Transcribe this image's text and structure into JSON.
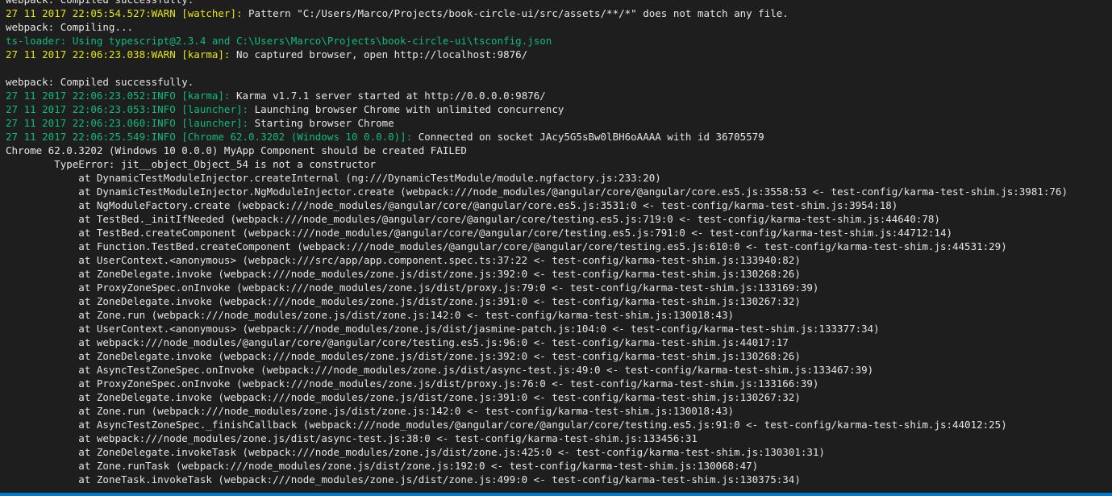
{
  "terminal": {
    "lines": [
      [
        {
          "text": "webpack: Compiled successfully.",
          "color": "white"
        }
      ],
      [
        {
          "text": "27 11 2017 22:05:54.527:WARN [watcher]: ",
          "color": "yellow"
        },
        {
          "text": "Pattern \"C:/Users/Marco/Projects/book-circle-ui/src/assets/**/*\" does not match any file.",
          "color": "white"
        }
      ],
      [
        {
          "text": "webpack: Compiling...",
          "color": "white"
        }
      ],
      [
        {
          "text": "ts-loader: Using typescript@2.3.4 and C:\\Users\\Marco\\Projects\\book-circle-ui\\tsconfig.json",
          "color": "green"
        }
      ],
      [
        {
          "text": "27 11 2017 22:06:23.038:WARN [karma]: ",
          "color": "yellow"
        },
        {
          "text": "No captured browser, open http://localhost:9876/",
          "color": "white"
        }
      ],
      [
        {
          "text": "",
          "color": "white"
        }
      ],
      [
        {
          "text": "webpack: Compiled successfully.",
          "color": "white"
        }
      ],
      [
        {
          "text": "27 11 2017 22:06:23.052:INFO [karma]: ",
          "color": "green"
        },
        {
          "text": "Karma v1.7.1 server started at http://0.0.0.0:9876/",
          "color": "white"
        }
      ],
      [
        {
          "text": "27 11 2017 22:06:23.053:INFO [launcher]: ",
          "color": "green"
        },
        {
          "text": "Launching browser Chrome with unlimited concurrency",
          "color": "white"
        }
      ],
      [
        {
          "text": "27 11 2017 22:06:23.060:INFO [launcher]: ",
          "color": "green"
        },
        {
          "text": "Starting browser Chrome",
          "color": "white"
        }
      ],
      [
        {
          "text": "27 11 2017 22:06:25.549:INFO [Chrome 62.0.3202 (Windows 10 0.0.0)]: ",
          "color": "green"
        },
        {
          "text": "Connected on socket JAcy5G5sBw0lBH6oAAAA with id 36705579",
          "color": "white"
        }
      ],
      [
        {
          "text": "Chrome 62.0.3202 (Windows 10 0.0.0) MyApp Component should be created FAILED",
          "color": "white"
        }
      ],
      [
        {
          "text": "        TypeError: jit__object_Object_54 is not a constructor",
          "color": "white"
        }
      ],
      [
        {
          "text": "            at DynamicTestModuleInjector.createInternal (ng:///DynamicTestModule/module.ngfactory.js:233:20)",
          "color": "white"
        }
      ],
      [
        {
          "text": "            at DynamicTestModuleInjector.NgModuleInjector.create (webpack:///node_modules/@angular/core/@angular/core.es5.js:3558:53 <- test-config/karma-test-shim.js:3981:76)",
          "color": "white"
        }
      ],
      [
        {
          "text": "            at NgModuleFactory.create (webpack:///node_modules/@angular/core/@angular/core.es5.js:3531:0 <- test-config/karma-test-shim.js:3954:18)",
          "color": "white"
        }
      ],
      [
        {
          "text": "            at TestBed._initIfNeeded (webpack:///node_modules/@angular/core/@angular/core/testing.es5.js:719:0 <- test-config/karma-test-shim.js:44640:78)",
          "color": "white"
        }
      ],
      [
        {
          "text": "            at TestBed.createComponent (webpack:///node_modules/@angular/core/@angular/core/testing.es5.js:791:0 <- test-config/karma-test-shim.js:44712:14)",
          "color": "white"
        }
      ],
      [
        {
          "text": "            at Function.TestBed.createComponent (webpack:///node_modules/@angular/core/@angular/core/testing.es5.js:610:0 <- test-config/karma-test-shim.js:44531:29)",
          "color": "white"
        }
      ],
      [
        {
          "text": "            at UserContext.<anonymous> (webpack:///src/app/app.component.spec.ts:37:22 <- test-config/karma-test-shim.js:133940:82)",
          "color": "white"
        }
      ],
      [
        {
          "text": "            at ZoneDelegate.invoke (webpack:///node_modules/zone.js/dist/zone.js:392:0 <- test-config/karma-test-shim.js:130268:26)",
          "color": "white"
        }
      ],
      [
        {
          "text": "            at ProxyZoneSpec.onInvoke (webpack:///node_modules/zone.js/dist/proxy.js:79:0 <- test-config/karma-test-shim.js:133169:39)",
          "color": "white"
        }
      ],
      [
        {
          "text": "            at ZoneDelegate.invoke (webpack:///node_modules/zone.js/dist/zone.js:391:0 <- test-config/karma-test-shim.js:130267:32)",
          "color": "white"
        }
      ],
      [
        {
          "text": "            at Zone.run (webpack:///node_modules/zone.js/dist/zone.js:142:0 <- test-config/karma-test-shim.js:130018:43)",
          "color": "white"
        }
      ],
      [
        {
          "text": "            at UserContext.<anonymous> (webpack:///node_modules/zone.js/dist/jasmine-patch.js:104:0 <- test-config/karma-test-shim.js:133377:34)",
          "color": "white"
        }
      ],
      [
        {
          "text": "            at webpack:///node_modules/@angular/core/@angular/core/testing.es5.js:96:0 <- test-config/karma-test-shim.js:44017:17",
          "color": "white"
        }
      ],
      [
        {
          "text": "            at ZoneDelegate.invoke (webpack:///node_modules/zone.js/dist/zone.js:392:0 <- test-config/karma-test-shim.js:130268:26)",
          "color": "white"
        }
      ],
      [
        {
          "text": "            at AsyncTestZoneSpec.onInvoke (webpack:///node_modules/zone.js/dist/async-test.js:49:0 <- test-config/karma-test-shim.js:133467:39)",
          "color": "white"
        }
      ],
      [
        {
          "text": "            at ProxyZoneSpec.onInvoke (webpack:///node_modules/zone.js/dist/proxy.js:76:0 <- test-config/karma-test-shim.js:133166:39)",
          "color": "white"
        }
      ],
      [
        {
          "text": "            at ZoneDelegate.invoke (webpack:///node_modules/zone.js/dist/zone.js:391:0 <- test-config/karma-test-shim.js:130267:32)",
          "color": "white"
        }
      ],
      [
        {
          "text": "            at Zone.run (webpack:///node_modules/zone.js/dist/zone.js:142:0 <- test-config/karma-test-shim.js:130018:43)",
          "color": "white"
        }
      ],
      [
        {
          "text": "            at AsyncTestZoneSpec._finishCallback (webpack:///node_modules/@angular/core/@angular/core/testing.es5.js:91:0 <- test-config/karma-test-shim.js:44012:25)",
          "color": "white"
        }
      ],
      [
        {
          "text": "            at webpack:///node_modules/zone.js/dist/async-test.js:38:0 <- test-config/karma-test-shim.js:133456:31",
          "color": "white"
        }
      ],
      [
        {
          "text": "            at ZoneDelegate.invokeTask (webpack:///node_modules/zone.js/dist/zone.js:425:0 <- test-config/karma-test-shim.js:130301:31)",
          "color": "white"
        }
      ],
      [
        {
          "text": "            at Zone.runTask (webpack:///node_modules/zone.js/dist/zone.js:192:0 <- test-config/karma-test-shim.js:130068:47)",
          "color": "white"
        }
      ],
      [
        {
          "text": "            at ZoneTask.invokeTask (webpack:///node_modules/zone.js/dist/zone.js:499:0 <- test-config/karma-test-shim.js:130375:34)",
          "color": "white"
        }
      ]
    ]
  },
  "colors": {
    "background": "#1e1e1e",
    "yellow": "#e5e510",
    "green": "#0dbc79",
    "white": "#e5e5e5",
    "status_bar": "#007acc"
  }
}
